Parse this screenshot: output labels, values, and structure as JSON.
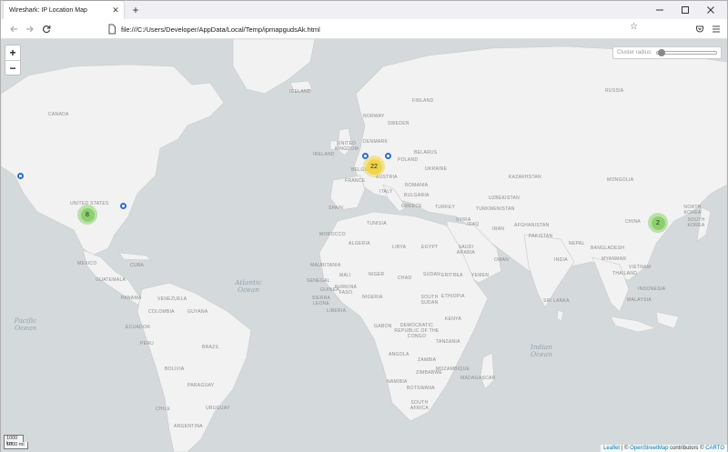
{
  "browser": {
    "tab_title": "Wireshark: IP Location Map",
    "tab_close": "✕",
    "new_tab": "+",
    "url": "file:///C:/Users/Developer/AppData/Local/Temp/ipmapgudsAk.html"
  },
  "map": {
    "zoom_in": "+",
    "zoom_out": "−",
    "cluster_radius_label": "Cluster radius:",
    "cluster_radius_value": 0.05,
    "countries": [
      "CANADA",
      "UNITED STATES",
      "MEXICO",
      "CUBA",
      "GUATEMALA",
      "PANAMA",
      "VENEZUELA",
      "COLOMBIA",
      "GUYANA",
      "ECUADOR",
      "PERU",
      "BRAZIL",
      "BOLIVIA",
      "PARAGUAY",
      "CHILE",
      "ARGENTINA",
      "URUGUAY",
      "ICELAND",
      "NORWAY",
      "SWEDEN",
      "FINLAND",
      "UNITED KINGDOM",
      "IRELAND",
      "DENMARK",
      "BELGIUM",
      "POLAND",
      "BELARUS",
      "UKRAINE",
      "FRANCE",
      "AUSTRIA",
      "ITALY",
      "SPAIN",
      "ROMANIA",
      "BULGARIA",
      "GREECE",
      "TURKEY",
      "RUSSIA",
      "KAZAKHSTAN",
      "UZBEKISTAN",
      "TURKMENISTAN",
      "AFGHANISTAN",
      "IRAN",
      "IRAQ",
      "SYRIA",
      "SAUDI ARABIA",
      "EGYPT",
      "LIBYA",
      "TUNISIA",
      "ALGERIA",
      "MOROCCO",
      "MAURITANIA",
      "MALI",
      "NIGER",
      "CHAD",
      "SUDAN",
      "ERITREA",
      "YEMEN",
      "OMAN",
      "SENEGAL",
      "GUINEA",
      "SIERRA LEONE",
      "LIBERIA",
      "BURKINA FASO",
      "NIGERIA",
      "ETHIOPIA",
      "SOUTH SUDAN",
      "GABON",
      "DEMOCRATIC REPUBLIC OF THE CONGO",
      "KENYA",
      "TANZANIA",
      "ANGOLA",
      "ZAMBIA",
      "ZIMBABWE",
      "NAMIBIA",
      "BOTSWANA",
      "SOUTH AFRICA",
      "MOZAMBIQUE",
      "MADAGASCAR",
      "PAKISTAN",
      "INDIA",
      "NEPAL",
      "BANGLADESH",
      "MYANMAR",
      "THAILAND",
      "CHINA",
      "MONGOLIA",
      "NORTH KOREA",
      "SOUTH KOREA",
      "VIETNAM",
      "MALAYSIA",
      "INDONESIA",
      "SRI LANKA"
    ],
    "oceans": {
      "atlantic": "Atlantic Ocean",
      "pacific": "Pacific Ocean",
      "indian": "Indian Ocean"
    },
    "clusters": [
      {
        "count": "8",
        "color": "#8bd06a",
        "location": "United States"
      },
      {
        "count": "22",
        "color": "#f0d44a",
        "location": "Europe"
      },
      {
        "count": "2",
        "color": "#8bd06a",
        "location": "China"
      }
    ],
    "scale_km": "1000 km",
    "scale_mi": "1000 mi",
    "attribution": {
      "leaflet": "Leaflet",
      "sep": " | © ",
      "osm": "OpenStreetMap",
      "contrib": " contributors © ",
      "carto": "CARTO"
    }
  }
}
